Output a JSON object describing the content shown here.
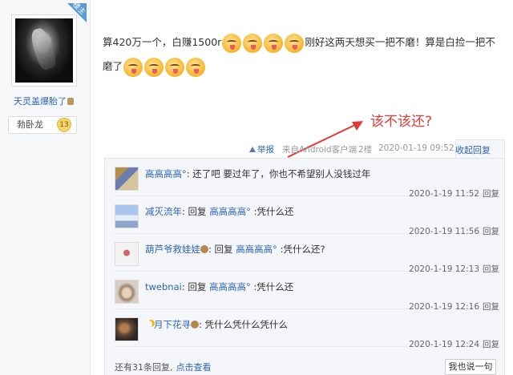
{
  "author": {
    "badge": "楼主",
    "username": "天灵盖爆胎了",
    "level_title": "勃卧龙",
    "level_number": "13"
  },
  "post": {
    "text_part1": "算420万一个，白赚1500r",
    "text_part2": "刚好这两天想买一把不磨！算是白捡一把不磨了",
    "emoji_row1": [
      "smile-tongue",
      "smile-tongue",
      "smile-tongue",
      "smile-tongue"
    ],
    "emoji_row2": [
      "smile-tongue",
      "smile-tongue",
      "smile-tongue",
      "smile-tongue"
    ]
  },
  "annotation": {
    "text": "该不该还?",
    "color": "#e53935"
  },
  "meta": {
    "report": "举报",
    "source": "来自Android客户端",
    "floor": "2楼",
    "date": "2020-01-19 09:52",
    "collapse": "收起回复"
  },
  "replies": [
    {
      "name": "高高高高°",
      "reply_prefix": "",
      "reply_to": "",
      "text": ": 还了吧 要过年了，你也不希望别人没钱过年",
      "time": "2020-1-19 11:52",
      "reply_label": "回复"
    },
    {
      "name": "减灭流年",
      "reply_prefix": ": 回复 ",
      "reply_to": "高高高高°",
      "text": " :凭什么还",
      "time": "2020-1-19 11:56",
      "reply_label": "回复"
    },
    {
      "name": "葫芦爷救娃娃",
      "reply_prefix": ": 回复 ",
      "reply_to": "高高高高°",
      "text": " :凭什么还?",
      "time": "2020-1-19 12:13",
      "reply_label": "回复"
    },
    {
      "name": "twebnai",
      "reply_prefix": ": 回复 ",
      "reply_to": "高高高高°",
      "text": " :凭什么还",
      "time": "2020-1-19 12:16",
      "reply_label": "回复"
    },
    {
      "name": "月下花寻",
      "reply_prefix": "",
      "reply_to": "",
      "text": ": 凭什么凭什么凭什么",
      "time": "2020-1-19 12:24",
      "reply_label": "回复"
    }
  ],
  "footer": {
    "more_count": "还有31条回复,",
    "more_link": "点击查看",
    "say_button": "我也说一句"
  },
  "colors": {
    "link": "#2d64b3",
    "annotation_red": "#e53935"
  }
}
